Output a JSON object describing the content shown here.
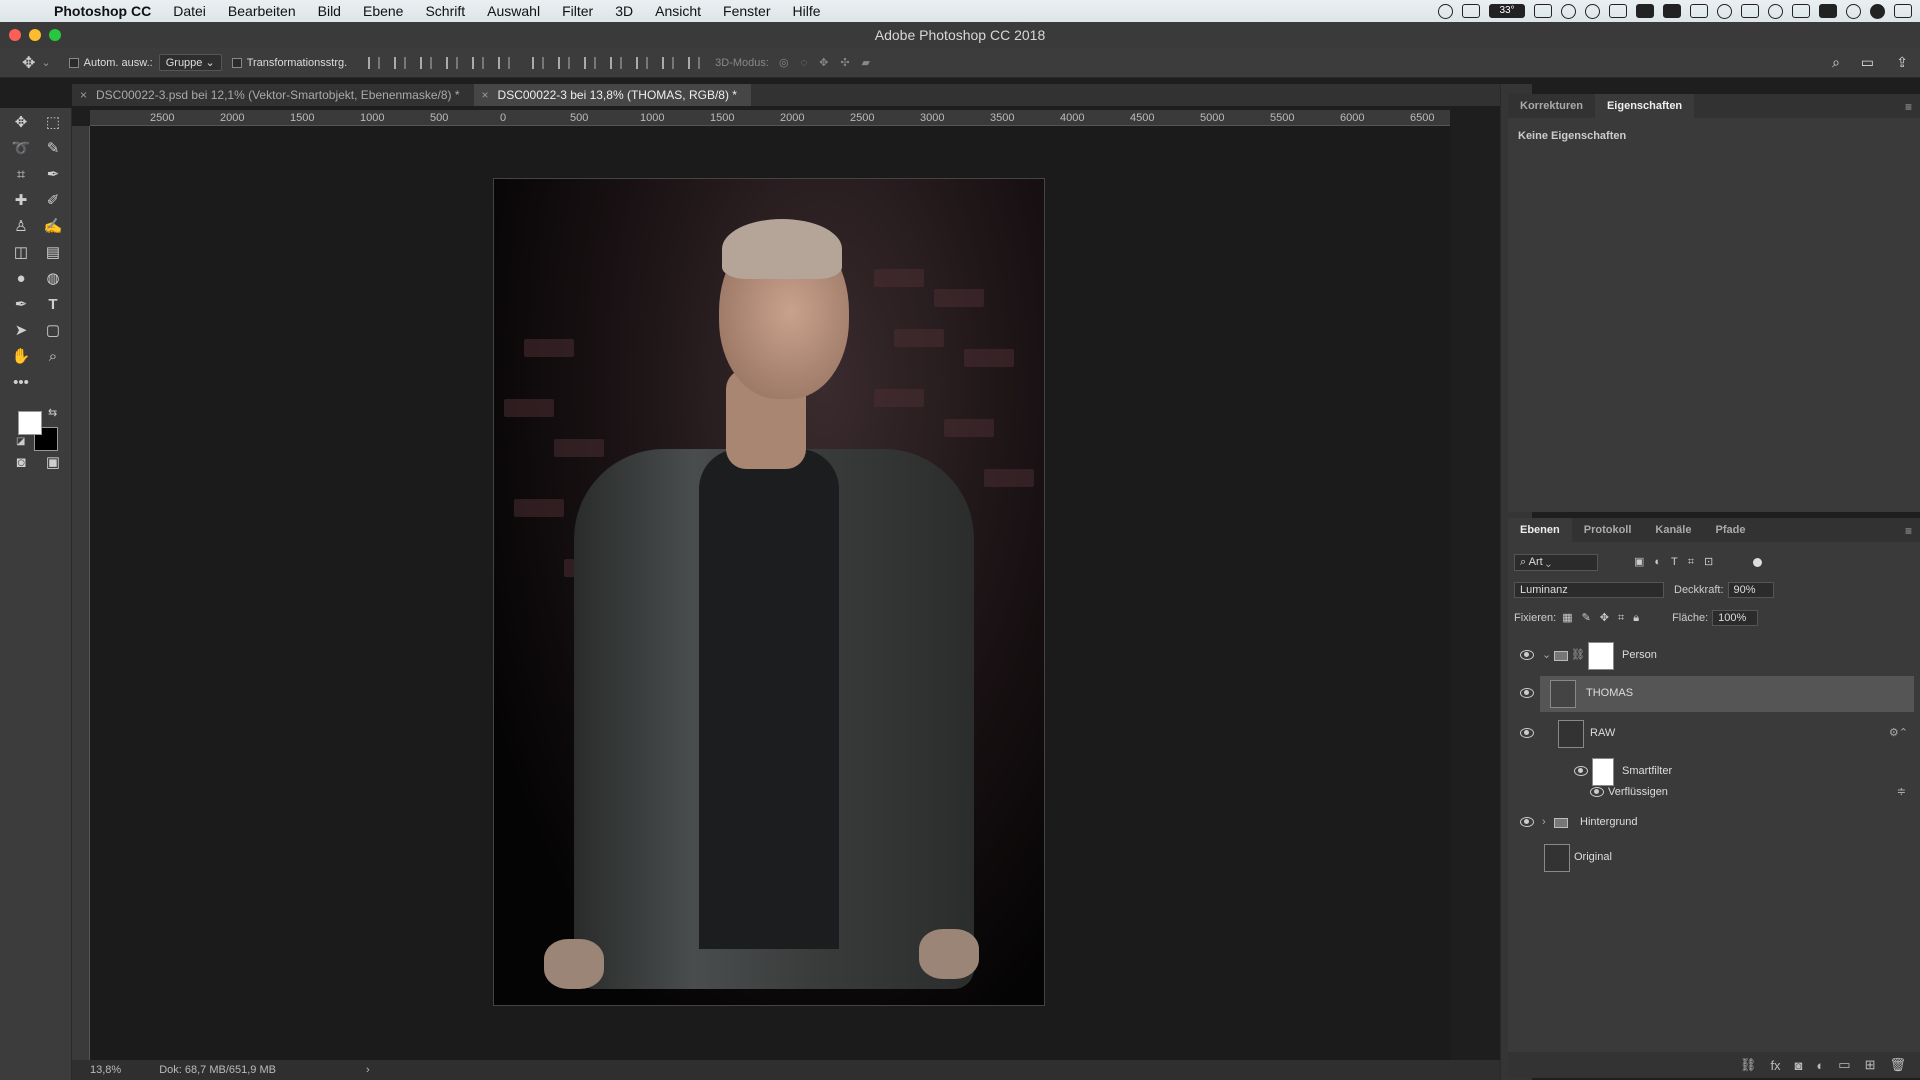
{
  "menubar": {
    "app": "Photoshop CC",
    "items": [
      "Datei",
      "Bearbeiten",
      "Bild",
      "Ebene",
      "Schrift",
      "Auswahl",
      "Filter",
      "3D",
      "Ansicht",
      "Fenster",
      "Hilfe"
    ],
    "battery_badge": "33°"
  },
  "window": {
    "title": "Adobe Photoshop CC 2018"
  },
  "options": {
    "auto_select_label": "Autom. ausw.:",
    "auto_select_value": "Gruppe",
    "transform_label": "Transformationsstrg.",
    "mode3d_label": "3D-Modus:"
  },
  "tabs": [
    {
      "label": "DSC00022-3.psd bei 12,1% (Vektor-Smartobjekt, Ebenenmaske/8) *"
    },
    {
      "label": "DSC00022-3 bei 13,8% (THOMAS, RGB/8) *"
    }
  ],
  "ruler": {
    "h_ticks": [
      "2500",
      "2000",
      "1500",
      "1000",
      "500",
      "0",
      "500",
      "1000",
      "1500",
      "2000",
      "2500",
      "3000",
      "3500",
      "4000",
      "4500",
      "5000",
      "5500",
      "6000",
      "6500"
    ]
  },
  "statusbar": {
    "zoom": "13,8%",
    "doc_size": "Dok: 68,7 MB/651,9 MB"
  },
  "properties": {
    "tabs": [
      "Korrekturen",
      "Eigenschaften"
    ],
    "active_tab": "Eigenschaften",
    "empty_text": "Keine Eigenschaften"
  },
  "layers_panel": {
    "tabs": [
      "Ebenen",
      "Protokoll",
      "Kanäle",
      "Pfade"
    ],
    "filter_label": "Art",
    "blend_mode": "Luminanz",
    "opacity_label": "Deckkraft:",
    "opacity_value": "90%",
    "lock_label": "Fixieren:",
    "fill_label": "Fläche:",
    "fill_value": "100%",
    "layers": [
      {
        "name": "Person",
        "kind": "group",
        "visible": true,
        "expanded": true
      },
      {
        "name": "THOMAS",
        "kind": "layer",
        "visible": true,
        "selected": true
      },
      {
        "name": "RAW",
        "kind": "smartobject",
        "visible": true
      },
      {
        "name": "Smartfilter",
        "kind": "smartfilter",
        "visible": true
      },
      {
        "name": "Verflüssigen",
        "kind": "filter",
        "visible": true
      },
      {
        "name": "Hintergrund",
        "kind": "group",
        "visible": true,
        "expanded": false
      },
      {
        "name": "Original",
        "kind": "smartobject",
        "visible": false
      }
    ]
  },
  "colors": {
    "foreground": "#ffffff",
    "background": "#000000",
    "selected_layer": "#555555",
    "panel": "#3a3a3a"
  }
}
